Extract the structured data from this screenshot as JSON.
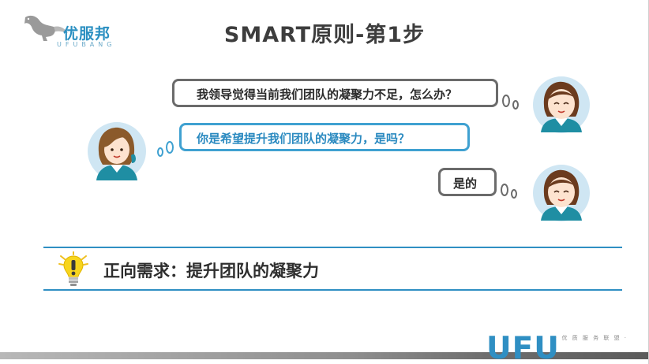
{
  "logo": {
    "name_cn": "优服邦",
    "name_en": "UFUBANG"
  },
  "title": "SMART原则-第1步",
  "dialog": [
    {
      "speaker": "right",
      "text": "我领导觉得当前我们团队的凝聚力不足，怎么办？"
    },
    {
      "speaker": "left",
      "text": "你是希望提升我们团队的凝聚力，是吗？"
    },
    {
      "speaker": "right",
      "text": "是的"
    }
  ],
  "need": {
    "text": "正向需求：提升团队的凝聚力"
  },
  "footer": {
    "brand": "UFU",
    "tagline": "· 优 质 服 务 联 盟 ·"
  },
  "colors": {
    "accent": "#2f8fc3",
    "bubble_gray": "#6b6b6b",
    "bubble_blue": "#3fa1d1",
    "avatar_bg": "#cfe6f3"
  }
}
